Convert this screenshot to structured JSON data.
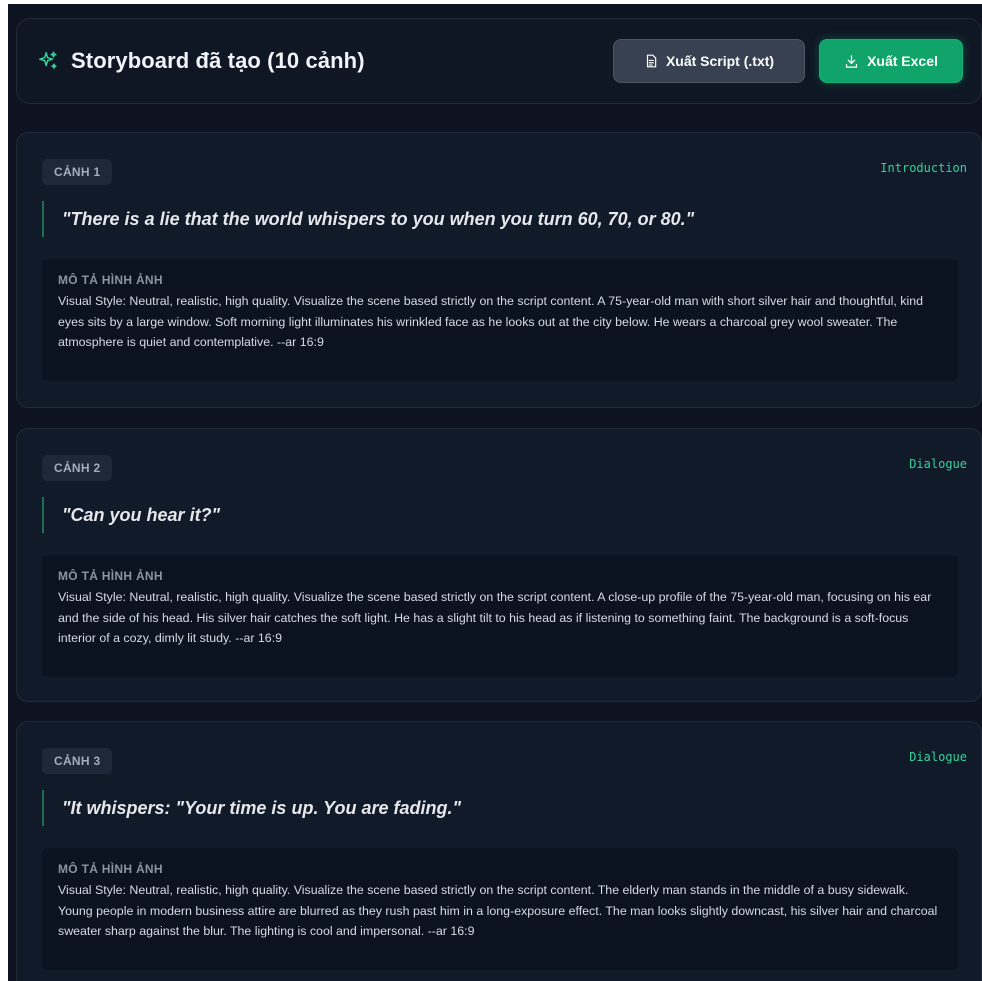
{
  "header": {
    "title": "Storyboard đã tạo (10 cảnh)",
    "export_script_label": "Xuất Script (.txt)",
    "export_excel_label": "Xuất Excel",
    "icons": {
      "title": "sparkles-icon",
      "script": "file-text-icon",
      "excel": "download-icon"
    }
  },
  "colors": {
    "accent": "#10a36a",
    "accent_text": "#34d399",
    "background": "#0d1321",
    "card": "#111a29"
  },
  "visual_label": "MÔ TẢ HÌNH ẢNH",
  "scenes": [
    {
      "label": "CẢNH 1",
      "type": "Introduction",
      "quote": "\"There is a lie that the world whispers to you when you turn 60, 70, or 80.\"",
      "description": "Visual Style: Neutral, realistic, high quality. Visualize the scene based strictly on the script content. A 75-year-old man with short silver hair and thoughtful, kind eyes sits by a large window. Soft morning light illuminates his wrinkled face as he looks out at the city below. He wears a charcoal grey wool sweater. The atmosphere is quiet and contemplative. --ar 16:9"
    },
    {
      "label": "CẢNH 2",
      "type": "Dialogue",
      "quote": "\"Can you hear it?\"",
      "description": "Visual Style: Neutral, realistic, high quality. Visualize the scene based strictly on the script content. A close-up profile of the 75-year-old man, focusing on his ear and the side of his head. His silver hair catches the soft light. He has a slight tilt to his head as if listening to something faint. The background is a soft-focus interior of a cozy, dimly lit study. --ar 16:9"
    },
    {
      "label": "CẢNH 3",
      "type": "Dialogue",
      "quote": "\"It whispers: \"Your time is up. You are fading.\"",
      "description": "Visual Style: Neutral, realistic, high quality. Visualize the scene based strictly on the script content. The elderly man stands in the middle of a busy sidewalk. Young people in modern business attire are blurred as they rush past him in a long-exposure effect. The man looks slightly downcast, his silver hair and charcoal sweater sharp against the blur. The lighting is cool and impersonal. --ar 16:9"
    }
  ]
}
